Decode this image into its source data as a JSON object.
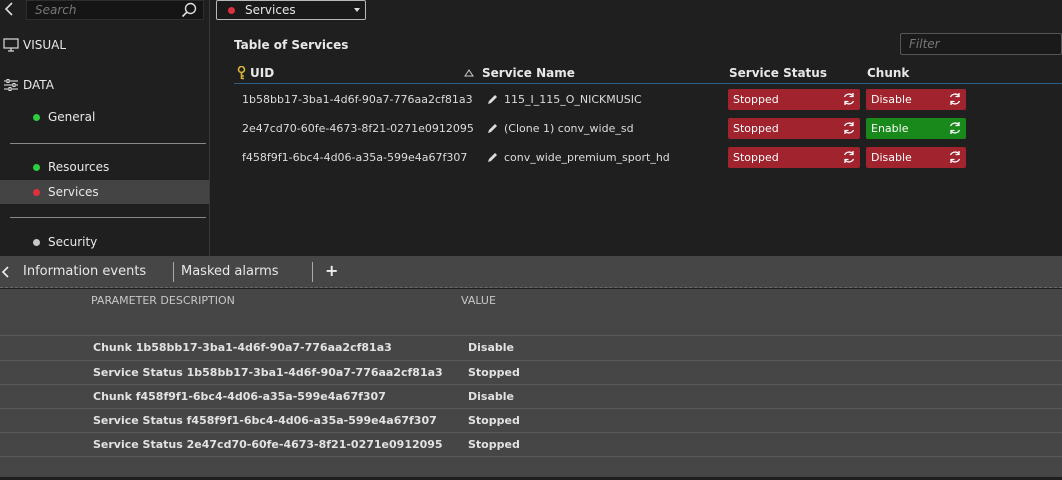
{
  "sidebar": {
    "search_placeholder": "Search",
    "sections": [
      {
        "label": "VISUAL",
        "icon": "monitor-icon"
      },
      {
        "label": "DATA",
        "icon": "sliders-icon"
      }
    ],
    "items": [
      {
        "label": "General",
        "dot_color": "#2ecc40"
      },
      {
        "label": "Resources",
        "dot_color": "#2ecc40"
      },
      {
        "label": "Services",
        "dot_color": "#e03040",
        "active": true
      },
      {
        "label": "Security",
        "dot_color": "#c8c8c8"
      }
    ]
  },
  "main": {
    "dropdown": {
      "label": "Services",
      "dot_color": "#e03040"
    },
    "table_title": "Table of Services",
    "filter_placeholder": "Filter",
    "columns": {
      "uid": "UID",
      "service_name": "Service Name",
      "service_status": "Service Status",
      "chunk": "Chunk"
    },
    "rows": [
      {
        "uid": "1b58bb17-3ba1-4d6f-90a7-776aa2cf81a3",
        "name": "115_I_115_O_NICKMUSIC",
        "status": "Stopped",
        "chunk": "Disable"
      },
      {
        "uid": "2e47cd70-60fe-4673-8f21-0271e0912095",
        "name": "(Clone 1) conv_wide_sd",
        "status": "Stopped",
        "chunk": "Enable"
      },
      {
        "uid": "f458f9f1-6bc4-4d06-a35a-599e4a67f307",
        "name": "conv_wide_premium_sport_hd",
        "status": "Stopped",
        "chunk": "Disable"
      }
    ]
  },
  "bottom": {
    "tabs": [
      "Information events",
      "Masked alarms"
    ],
    "add_label": "+",
    "headers": {
      "description": "PARAMETER DESCRIPTION",
      "value": "VALUE"
    },
    "params": [
      {
        "description": "Chunk 1b58bb17-3ba1-4d6f-90a7-776aa2cf81a3",
        "value": "Disable"
      },
      {
        "description": "Service Status 1b58bb17-3ba1-4d6f-90a7-776aa2cf81a3",
        "value": "Stopped"
      },
      {
        "description": "Chunk f458f9f1-6bc4-4d06-a35a-599e4a67f307",
        "value": "Disable"
      },
      {
        "description": "Service Status f458f9f1-6bc4-4d06-a35a-599e4a67f307",
        "value": "Stopped"
      },
      {
        "description": "Service Status 2e47cd70-60fe-4673-8f21-0271e0912095",
        "value": "Stopped"
      }
    ]
  },
  "colors": {
    "stopped": "#a0232d",
    "disable": "#a0232d",
    "enable": "#18891a",
    "accent": "#2d5d8a"
  }
}
